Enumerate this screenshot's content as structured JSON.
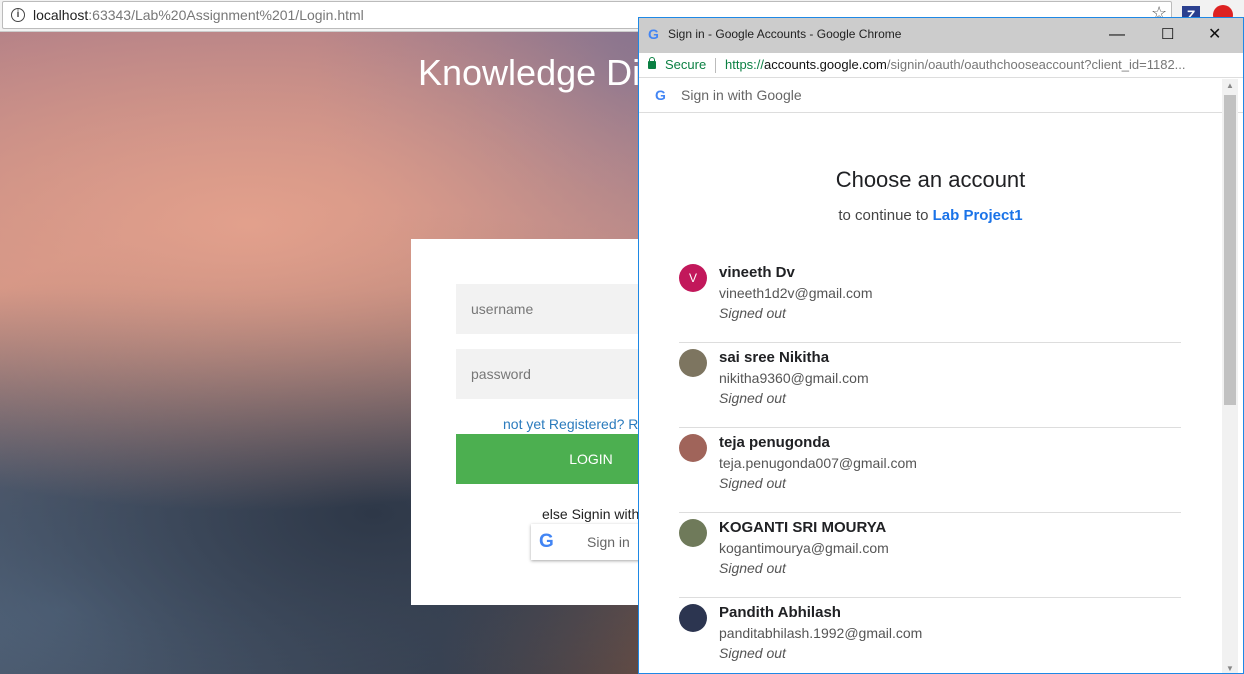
{
  "browser": {
    "url_host": "localhost",
    "url_rest": ":63343/Lab%20Assignment%201/Login.html",
    "ext1": "Z"
  },
  "page": {
    "title": "Knowledge Di",
    "username_placeholder": "username",
    "password_placeholder": "password",
    "register_link": "not yet Registered? R",
    "login_label": "LOGIN",
    "else_text": "else Signin with",
    "google_signin_label": "Sign in",
    "accent": "#4caf50"
  },
  "popup": {
    "window_title": "Sign in - Google Accounts - Google Chrome",
    "secure_label": "Secure",
    "url_scheme": "https://",
    "url_domain": "accounts.google.com",
    "url_path": "/signin/oauth/oauthchooseaccount?client_id=1182...",
    "signin_bar": "Sign in with Google",
    "heading": "Choose an account",
    "subtitle_prefix": "to continue to",
    "app_name": "Lab Project1",
    "accounts": [
      {
        "name": "vineeth Dv",
        "email": "vineeth1d2v@gmail.com",
        "status": "Signed out",
        "initial": "V",
        "color": "#c2185b"
      },
      {
        "name": "sai sree Nikitha",
        "email": "nikitha9360@gmail.com",
        "status": "Signed out",
        "initial": "",
        "color": "#7d7560"
      },
      {
        "name": "teja penugonda",
        "email": "teja.penugonda007@gmail.com",
        "status": "Signed out",
        "initial": "",
        "color": "#a0645a"
      },
      {
        "name": "KOGANTI SRI MOURYA",
        "email": "kogantimourya@gmail.com",
        "status": "Signed out",
        "initial": "",
        "color": "#6f7a5a"
      },
      {
        "name": "Pandith Abhilash",
        "email": "panditabhilash.1992@gmail.com",
        "status": "Signed out",
        "initial": "",
        "color": "#2c3550"
      }
    ]
  }
}
